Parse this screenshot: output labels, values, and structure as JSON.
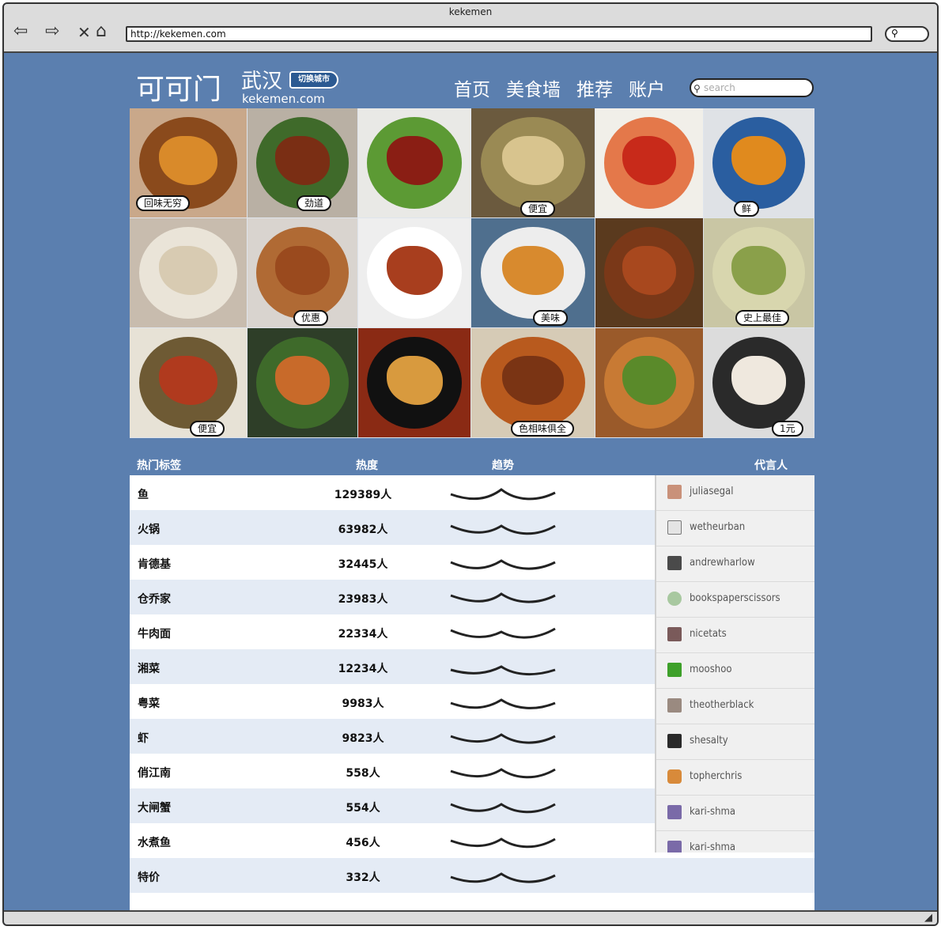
{
  "browser": {
    "title": "kekemen",
    "url": "http://kekemen.com"
  },
  "header": {
    "logo": "可可门",
    "city": "武汉",
    "switch_city": "切换城市",
    "domain": "kekemen.com",
    "nav": [
      "首页",
      "美食墙",
      "推荐",
      "账户"
    ],
    "search_placeholder": "search"
  },
  "photo_tags": [
    "回味无穷",
    "劲道",
    "便宜",
    "鲜",
    "优惠",
    "美味",
    "史上最佳",
    "便宜",
    "色相味俱全",
    "1元"
  ],
  "table": {
    "headers": {
      "tag": "热门标签",
      "heat": "热度",
      "trend": "趋势",
      "spokesperson": "代言人"
    },
    "rows": [
      {
        "tag": "鱼",
        "heat": "129389人"
      },
      {
        "tag": "火锅",
        "heat": "63982人"
      },
      {
        "tag": "肯德基",
        "heat": "32445人"
      },
      {
        "tag": "仓乔家",
        "heat": "23983人"
      },
      {
        "tag": "牛肉面",
        "heat": "22334人"
      },
      {
        "tag": "湘菜",
        "heat": "12234人"
      },
      {
        "tag": "粤菜",
        "heat": "9983人"
      },
      {
        "tag": "虾",
        "heat": "9823人"
      },
      {
        "tag": "俏江南",
        "heat": "558人"
      },
      {
        "tag": "大闸蟹",
        "heat": "554人"
      },
      {
        "tag": "水煮鱼",
        "heat": "456人"
      },
      {
        "tag": "特价",
        "heat": "332人"
      }
    ],
    "spokespeople": [
      "juliasegal",
      "wetheurban",
      "andrewharlow",
      "bookspaperscissors",
      "nicetats",
      "mooshoo",
      "theotherblack",
      "shesalty",
      "topherchris",
      "kari-shma",
      "kari-shma"
    ]
  }
}
